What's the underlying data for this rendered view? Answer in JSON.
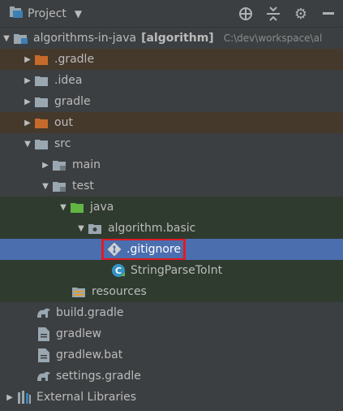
{
  "header": {
    "title": "Project",
    "icons": [
      "project-icon",
      "chevron-down-icon",
      "crosshair-icon",
      "collapse-all-icon",
      "gear-icon",
      "minimize-icon"
    ]
  },
  "colors": {
    "panel_bg": "#3c3f41",
    "excluded_bg": "#45392c",
    "test_bg": "#2f3b2f",
    "selected_bg": "#4b6eaf",
    "highlight_border": "#e01b24",
    "folder_grey": "#9aa7b0",
    "folder_orange": "#c66a2b",
    "folder_green": "#62b543"
  },
  "tree": {
    "root": {
      "name": "algorithms-in-java",
      "module": "[algorithm]",
      "path": "C:\\dev\\workspace\\al"
    },
    "gradle_dot": ".gradle",
    "idea": ".idea",
    "gradle": "gradle",
    "out": "out",
    "src": "src",
    "main": "main",
    "test": "test",
    "java": "java",
    "package": "algorithm.basic",
    "gitignore": ".gitignore",
    "class": "StringParseToInt",
    "resources": "resources",
    "build_gradle": "build.gradle",
    "gradlew": "gradlew",
    "gradlew_bat": "gradlew.bat",
    "settings_gradle": "settings.gradle",
    "external": "External Libraries"
  }
}
